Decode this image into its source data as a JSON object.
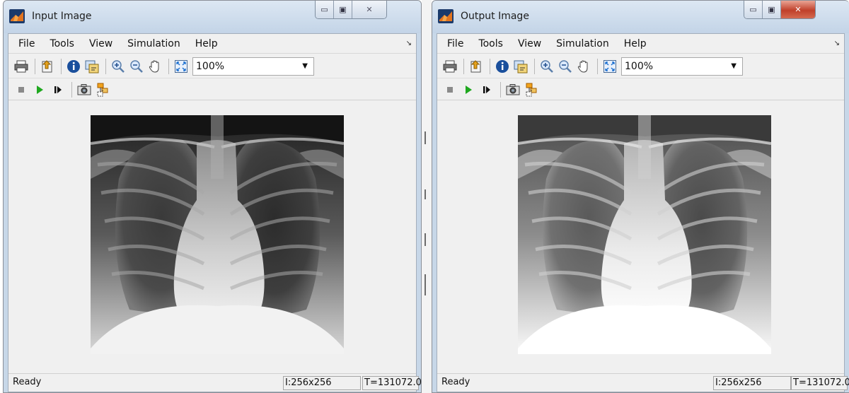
{
  "windows": [
    {
      "title": "Input Image",
      "menu": [
        "File",
        "Tools",
        "View",
        "Simulation",
        "Help"
      ],
      "zoom": "100%",
      "status": {
        "text": "Ready",
        "size": "I:256x256",
        "time": "T=131072.0"
      },
      "close_style": "plain",
      "image_tone": "original"
    },
    {
      "title": "Output Image",
      "menu": [
        "File",
        "Tools",
        "View",
        "Simulation",
        "Help"
      ],
      "zoom": "100%",
      "status": {
        "text": "Ready",
        "size": "I:256x256",
        "time": "T=131072.0"
      },
      "close_style": "red",
      "image_tone": "brightened"
    }
  ],
  "icons": {
    "toolbar1": [
      "print-icon",
      "export-icon",
      "info-icon",
      "fit-to-window-icon",
      "zoom-in-icon",
      "zoom-out-icon",
      "pan-hand-icon",
      "maintain-fit-icon"
    ],
    "toolbar2": [
      "stop-icon",
      "play-icon",
      "step-forward-icon",
      "snapshot-icon",
      "highlight-block-icon"
    ]
  },
  "colors": {
    "window_frame": "#c7d7e8",
    "client_bg": "#f0f0f0",
    "close_red": "#c0402a",
    "play_green": "#1fa81f"
  }
}
